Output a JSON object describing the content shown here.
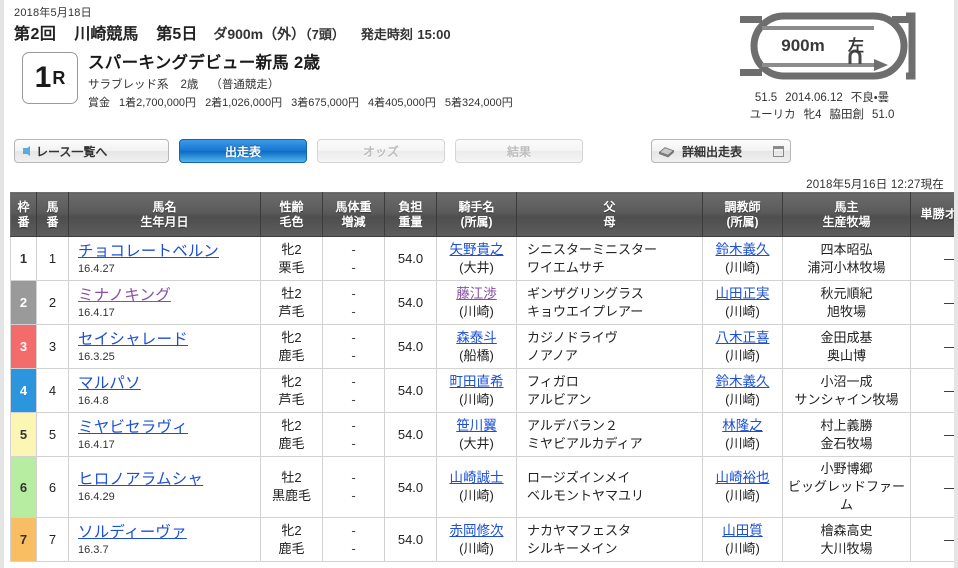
{
  "header": {
    "date": "2018年5月18日",
    "meeting_round": "第2回",
    "venue": "川崎競馬",
    "day": "第5日",
    "course": "ダ900m（外）",
    "field_size": "（7頭）",
    "post_time_label": "発走時刻",
    "post_time": "15:00",
    "race_number": "1",
    "race_number_suffix": "R",
    "race_name": "スパーキングデビュー新馬 2歳",
    "breed": "サラブレッド系",
    "age_cond": "2歳",
    "race_class": "（普通競走）",
    "prize_label": "賞金",
    "prizes": [
      "1着2,700,000円",
      "2着1,026,000円",
      "3着675,000円",
      "4着405,000円",
      "5着324,000円"
    ]
  },
  "track": {
    "distance": "900m",
    "direction": "左",
    "record_time": "51.5",
    "record_date": "2014.06.12",
    "record_condition": "不良・曇",
    "record_horse": "ユーリカ",
    "record_horse_sexage": "牝4",
    "record_jockey": "脇田創",
    "record_weight": "51.0"
  },
  "nav": {
    "back_label": "レース一覧へ",
    "tabs": [
      {
        "label": "出走表",
        "state": "active"
      },
      {
        "label": "オッズ",
        "state": "disabled"
      },
      {
        "label": "結果",
        "state": "disabled"
      }
    ],
    "detail_label": "詳細出走表",
    "timestamp": "2018年5月16日 12:27現在"
  },
  "table": {
    "headers": [
      {
        "line1": "枠",
        "line2": "番"
      },
      {
        "line1": "馬",
        "line2": "番"
      },
      {
        "line1": "馬名",
        "line2": "生年月日"
      },
      {
        "line1": "性齢",
        "line2": "毛色"
      },
      {
        "line1": "馬体重",
        "line2": "増減"
      },
      {
        "line1": "負担",
        "line2": "重量"
      },
      {
        "line1": "騎手名",
        "line2": "(所属)"
      },
      {
        "line1": "父",
        "line2": "母"
      },
      {
        "line1": "調教師",
        "line2": "(所属)"
      },
      {
        "line1": "馬主",
        "line2": "生産牧場"
      },
      {
        "line1": "単勝オッズ",
        "line2": ""
      }
    ],
    "frame_colors": {
      "1": "#ffffff",
      "2": "#9a9a9a",
      "3": "#f46b6b",
      "4": "#2b95de",
      "5": "#fbf6b3",
      "6": "#b6eda0",
      "7": "#f9bd62"
    },
    "frame_text_colors": {
      "1": "#333333",
      "2": "#ffffff",
      "3": "#ffffff",
      "4": "#ffffff",
      "5": "#333333",
      "6": "#333333",
      "7": "#333333"
    },
    "rows": [
      {
        "waku": "1",
        "uma": "1",
        "name": "チョコレートベルン",
        "birth": "16.4.27",
        "visited": false,
        "sex_age": "牝2",
        "coat": "栗毛",
        "weight": "-",
        "weight_diff": "-",
        "load": "54.0",
        "jockey": "矢野貴之",
        "jockey_belong": "(大井)",
        "jockey_visited": false,
        "sire": "シニスターミニスター",
        "dam": "ワイエムサチ",
        "trainer": "鈴木義久",
        "trainer_belong": "(川崎)",
        "trainer_visited": false,
        "owner": "四本昭弘",
        "farm": "浦河小林牧場",
        "odds": "―"
      },
      {
        "waku": "2",
        "uma": "2",
        "name": "ミナノキング",
        "birth": "16.4.17",
        "visited": true,
        "sex_age": "牡2",
        "coat": "芦毛",
        "weight": "-",
        "weight_diff": "-",
        "load": "54.0",
        "jockey": "藤江渉",
        "jockey_belong": "(川崎)",
        "jockey_visited": true,
        "sire": "ギンザグリングラス",
        "dam": "キョウエイプレアー",
        "trainer": "山田正実",
        "trainer_belong": "(川崎)",
        "trainer_visited": false,
        "owner": "秋元順紀",
        "farm": "旭牧場",
        "odds": "―"
      },
      {
        "waku": "3",
        "uma": "3",
        "name": "セイシャレード",
        "birth": "16.3.25",
        "visited": false,
        "sex_age": "牝2",
        "coat": "鹿毛",
        "weight": "-",
        "weight_diff": "-",
        "load": "54.0",
        "jockey": "森泰斗",
        "jockey_belong": "(船橋)",
        "jockey_visited": false,
        "sire": "カジノドライヴ",
        "dam": "ノアノア",
        "trainer": "八木正喜",
        "trainer_belong": "(川崎)",
        "trainer_visited": false,
        "owner": "金田成基",
        "farm": "奥山博",
        "odds": "―"
      },
      {
        "waku": "4",
        "uma": "4",
        "name": "マルパソ",
        "birth": "16.4.8",
        "visited": false,
        "sex_age": "牝2",
        "coat": "芦毛",
        "weight": "-",
        "weight_diff": "-",
        "load": "54.0",
        "jockey": "町田直希",
        "jockey_belong": "(川崎)",
        "jockey_visited": false,
        "sire": "フィガロ",
        "dam": "アルビアン",
        "trainer": "鈴木義久",
        "trainer_belong": "(川崎)",
        "trainer_visited": false,
        "owner": "小沼一成",
        "farm": "サンシャイン牧場",
        "odds": "―"
      },
      {
        "waku": "5",
        "uma": "5",
        "name": "ミヤビセラヴィ",
        "birth": "16.4.17",
        "visited": false,
        "sex_age": "牝2",
        "coat": "鹿毛",
        "weight": "-",
        "weight_diff": "-",
        "load": "54.0",
        "jockey": "笹川翼",
        "jockey_belong": "(大井)",
        "jockey_visited": false,
        "sire": "アルデバラン２",
        "dam": "ミヤビアルカディア",
        "trainer": "林隆之",
        "trainer_belong": "(川崎)",
        "trainer_visited": false,
        "owner": "村上義勝",
        "farm": "金石牧場",
        "odds": "―"
      },
      {
        "waku": "6",
        "uma": "6",
        "name": "ヒロノアラムシャ",
        "birth": "16.4.29",
        "visited": false,
        "sex_age": "牡2",
        "coat": "黒鹿毛",
        "weight": "-",
        "weight_diff": "-",
        "load": "54.0",
        "jockey": "山崎誠士",
        "jockey_belong": "(川崎)",
        "jockey_visited": false,
        "sire": "ロージズインメイ",
        "dam": "ベルモントヤマユリ",
        "trainer": "山崎裕也",
        "trainer_belong": "(川崎)",
        "trainer_visited": false,
        "owner": "小野博郷",
        "farm": "ビッグレッドファーム",
        "odds": "―"
      },
      {
        "waku": "7",
        "uma": "7",
        "name": "ソルディーヴァ",
        "birth": "16.3.7",
        "visited": false,
        "sex_age": "牝2",
        "coat": "鹿毛",
        "weight": "-",
        "weight_diff": "-",
        "load": "54.0",
        "jockey": "赤岡修次",
        "jockey_belong": "(川崎)",
        "jockey_visited": false,
        "sire": "ナカヤマフェスタ",
        "dam": "シルキーメイン",
        "trainer": "山田質",
        "trainer_belong": "(川崎)",
        "trainer_visited": false,
        "owner": "檜森高史",
        "farm": "大川牧場",
        "odds": "―"
      }
    ]
  }
}
